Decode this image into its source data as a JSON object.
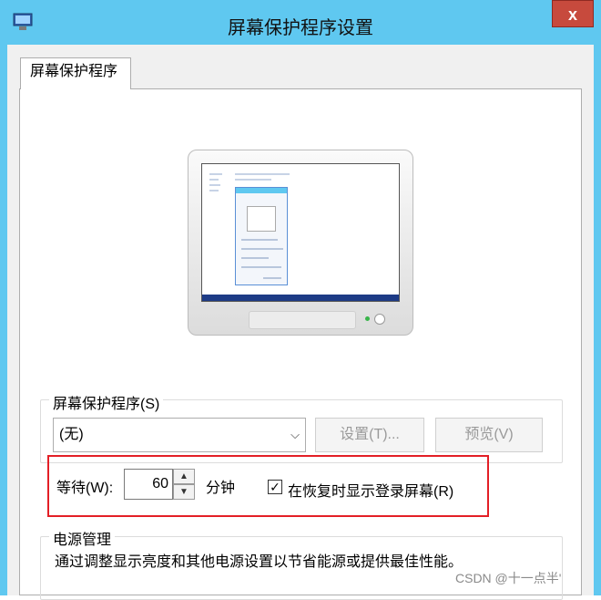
{
  "window": {
    "title": "屏幕保护程序设置",
    "close_label": "x"
  },
  "tabs": [
    {
      "label": "屏幕保护程序"
    }
  ],
  "screensaver": {
    "group_label": "屏幕保护程序(S)",
    "selected": "(无)",
    "settings_button": "设置(T)...",
    "preview_button": "预览(V)"
  },
  "wait": {
    "label": "等待(W):",
    "value": "60",
    "unit": "分钟",
    "resume_checkbox_label": "在恢复时显示登录屏幕(R)",
    "resume_checked": true
  },
  "power": {
    "group_label": "电源管理",
    "description": "通过调整显示亮度和其他电源设置以节省能源或提供最佳性能。"
  },
  "watermark": "CSDN @十一点半'",
  "colors": {
    "titlebar": "#5fc8f0",
    "close": "#c74a3d",
    "highlight": "#e31f26"
  }
}
